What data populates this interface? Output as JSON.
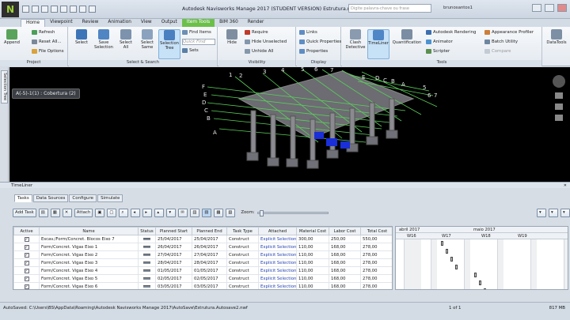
{
  "app": {
    "logo": "N",
    "title": "Autodesk Navisworks Manage 2017 (STUDENT VERSION)   Estrutura.nwf",
    "search_placeholder": "Digite palavra-chave ou frase",
    "user": "brunosantos1"
  },
  "tabs": [
    "Home",
    "Viewpoint",
    "Review",
    "Animation",
    "View",
    "Output",
    "Item Tools",
    "BIM 360",
    "Render"
  ],
  "ribbon": {
    "project": {
      "label": "Project",
      "append": "Append",
      "refresh": "Refresh",
      "reset_all": "Reset All...",
      "file_options": "File Options"
    },
    "select_search": {
      "label": "Select & Search",
      "select": "Select",
      "save_selection": "Save Selection",
      "select_all": "Select All",
      "select_same": "Select Same",
      "selection_tree": "Selection Tree",
      "find_items": "Find Items",
      "quick_find_placeholder": "Quick Find",
      "sets": "Sets"
    },
    "visibility": {
      "label": "Visibility",
      "hide": "Hide",
      "require": "Require",
      "hide_unselected": "Hide Unselected",
      "unhide_all": "Unhide All"
    },
    "display": {
      "label": "Display",
      "links": "Links",
      "quick_properties": "Quick Properties",
      "properties": "Properties"
    },
    "tools": {
      "label": "Tools",
      "clash_detective": "Clash Detective",
      "timeliner": "TimeLiner",
      "quantification": "Quantification",
      "autodesk_rendering": "Autodesk Rendering",
      "animator": "Animator",
      "scripter": "Scripter",
      "appearance_profiler": "Appearance Profiler",
      "batch_utility": "Batch Utility",
      "compare": "Compare",
      "datatools": "DataTools"
    }
  },
  "side_tab": "Selection Tree",
  "viewport": {
    "tooltip": "A(-5)-1(1) : Cobertura (2)",
    "grid_labels_left": [
      "F",
      "E",
      "D",
      "C",
      "B",
      "A"
    ],
    "grid_labels_top": [
      "1",
      "2",
      "3",
      "4",
      "5",
      "6",
      "7"
    ],
    "grid_labels_right": [
      "E",
      "D",
      "C",
      "B",
      "A"
    ],
    "grid_labels_right_num": [
      "5",
      "6",
      "7"
    ]
  },
  "timeliner": {
    "title": "TimeLiner",
    "tabs": [
      "Tasks",
      "Data Sources",
      "Configure",
      "Simulate"
    ],
    "add_task": "Add Task",
    "attach": "Attach",
    "zoom_label": "Zoom:",
    "columns": [
      "Active",
      "Name",
      "Status",
      "Planned Start",
      "Planned End",
      "Task Type",
      "Attached",
      "Material Cost",
      "Labor Cost",
      "Total Cost"
    ],
    "rows": [
      {
        "name": "Escav./Form/Concret. Blocos Eixo 7",
        "start": "25/04/2017",
        "end": "25/04/2017",
        "type": "Construct",
        "attached": "Explicit Selection",
        "material": "300,00",
        "labor": "250,00",
        "total": "550,00"
      },
      {
        "name": "Form/Concret. Vigas Eixo 1",
        "start": "26/04/2017",
        "end": "26/04/2017",
        "type": "Construct",
        "attached": "Explicit Selection",
        "material": "110,00",
        "labor": "168,00",
        "total": "278,00"
      },
      {
        "name": "Form/Concret. Vigas Eixo 2",
        "start": "27/04/2017",
        "end": "27/04/2017",
        "type": "Construct",
        "attached": "Explicit Selection",
        "material": "110,00",
        "labor": "168,00",
        "total": "278,00"
      },
      {
        "name": "Form/Concret. Vigas Eixo 3",
        "start": "28/04/2017",
        "end": "28/04/2017",
        "type": "Construct",
        "attached": "Explicit Selection",
        "material": "110,00",
        "labor": "168,00",
        "total": "278,00"
      },
      {
        "name": "Form/Concret. Vigas Eixo 4",
        "start": "01/05/2017",
        "end": "01/05/2017",
        "type": "Construct",
        "attached": "Explicit Selection",
        "material": "110,00",
        "labor": "168,00",
        "total": "278,00"
      },
      {
        "name": "Form/Concret. Vigas Eixo 5",
        "start": "02/05/2017",
        "end": "02/05/2017",
        "type": "Construct",
        "attached": "Explicit Selection",
        "material": "110,00",
        "labor": "168,00",
        "total": "278,00"
      },
      {
        "name": "Form/Concret. Vigas Eixo 6",
        "start": "03/05/2017",
        "end": "03/05/2017",
        "type": "Construct",
        "attached": "Explicit Selection",
        "material": "110,00",
        "labor": "168,00",
        "total": "278,00"
      }
    ],
    "gantt": {
      "months": [
        "abril 2017",
        "maio 2017"
      ],
      "weeks": [
        "W16",
        "W17",
        "W18",
        "W19"
      ]
    }
  },
  "statusbar": {
    "path": "AutoSaved: C:\\Users\\BS\\AppData\\Roaming\\Autodesk Navisworks Manage 2017\\AutoSave\\Estrutura.Autosave2.nwf",
    "page": "1 of 1",
    "memory": "817 MB"
  }
}
